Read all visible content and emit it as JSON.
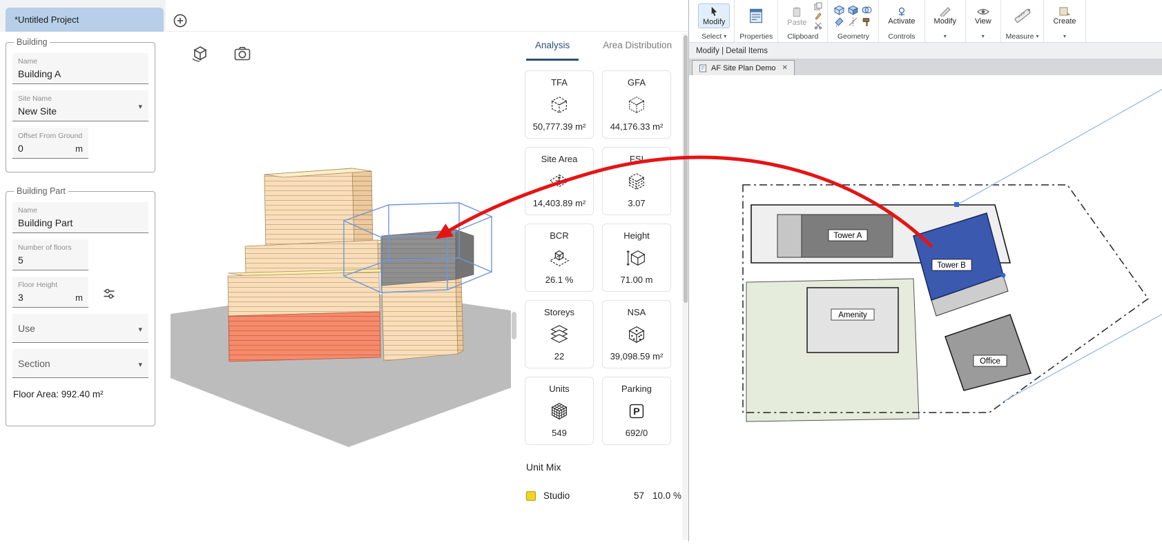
{
  "left_app": {
    "header": {
      "tab_title": "*Untitled Project"
    },
    "building": {
      "legend": "Building",
      "name_label": "Name",
      "name_value": "Building A",
      "site_label": "Site Name",
      "site_value": "New Site",
      "offset_label": "Offset From Ground",
      "offset_value": "0",
      "offset_unit": "m"
    },
    "building_part": {
      "legend": "Building Part",
      "name_label": "Name",
      "name_value": "Building Part",
      "floors_label": "Number of floors",
      "floors_value": "5",
      "floor_height_label": "Floor Height",
      "floor_height_value": "3",
      "floor_height_unit": "m",
      "use_label": "Use",
      "section_label": "Section",
      "floor_area": "Floor Area: 992.40 m²"
    },
    "analysis": {
      "tabs": [
        {
          "label": "Analysis"
        },
        {
          "label": "Area Distribution"
        }
      ],
      "active_tab": "Analysis",
      "metrics": [
        {
          "label": "TFA",
          "value": "50,777.39 m²"
        },
        {
          "label": "GFA",
          "value": "44,176.33 m²"
        },
        {
          "label": "Site Area",
          "value": "14,403.89 m²"
        },
        {
          "label": "FSI",
          "value": "3.07"
        },
        {
          "label": "BCR",
          "value": "26.1 %"
        },
        {
          "label": "Height",
          "value": "71.00 m"
        },
        {
          "label": "Storeys",
          "value": "22"
        },
        {
          "label": "NSA",
          "value": "39,098.59 m²"
        },
        {
          "label": "Units",
          "value": "549"
        },
        {
          "label": "Parking",
          "value": "692/0"
        }
      ],
      "unit_mix_title": "Unit Mix",
      "unit_mix": [
        {
          "label": "Studio",
          "count": "57",
          "percent": "10.0 %",
          "color": "#f0d428"
        }
      ]
    }
  },
  "revit": {
    "ribbon": {
      "select_button": "Modify",
      "select_label": "Select",
      "properties_label": "Properties",
      "paste_button": "Paste",
      "clipboard_label": "Clipboard",
      "geometry_label": "Geometry",
      "activate_button": "Activate",
      "controls_label": "Controls",
      "modify_panel_label": "Modify",
      "view_panel_label": "View",
      "measure_label": "Measure",
      "create_panel_label": "Create"
    },
    "context_bar": "Modify | Detail Items",
    "view_tab": "AF Site Plan Demo",
    "site_plan": {
      "tower_a": "Tower A",
      "tower_b": "Tower B",
      "amenity": "Amenity",
      "office": "Office",
      "selection_color": "#3c59b0"
    }
  },
  "annotation": {
    "arrow_color": "#e51414"
  }
}
